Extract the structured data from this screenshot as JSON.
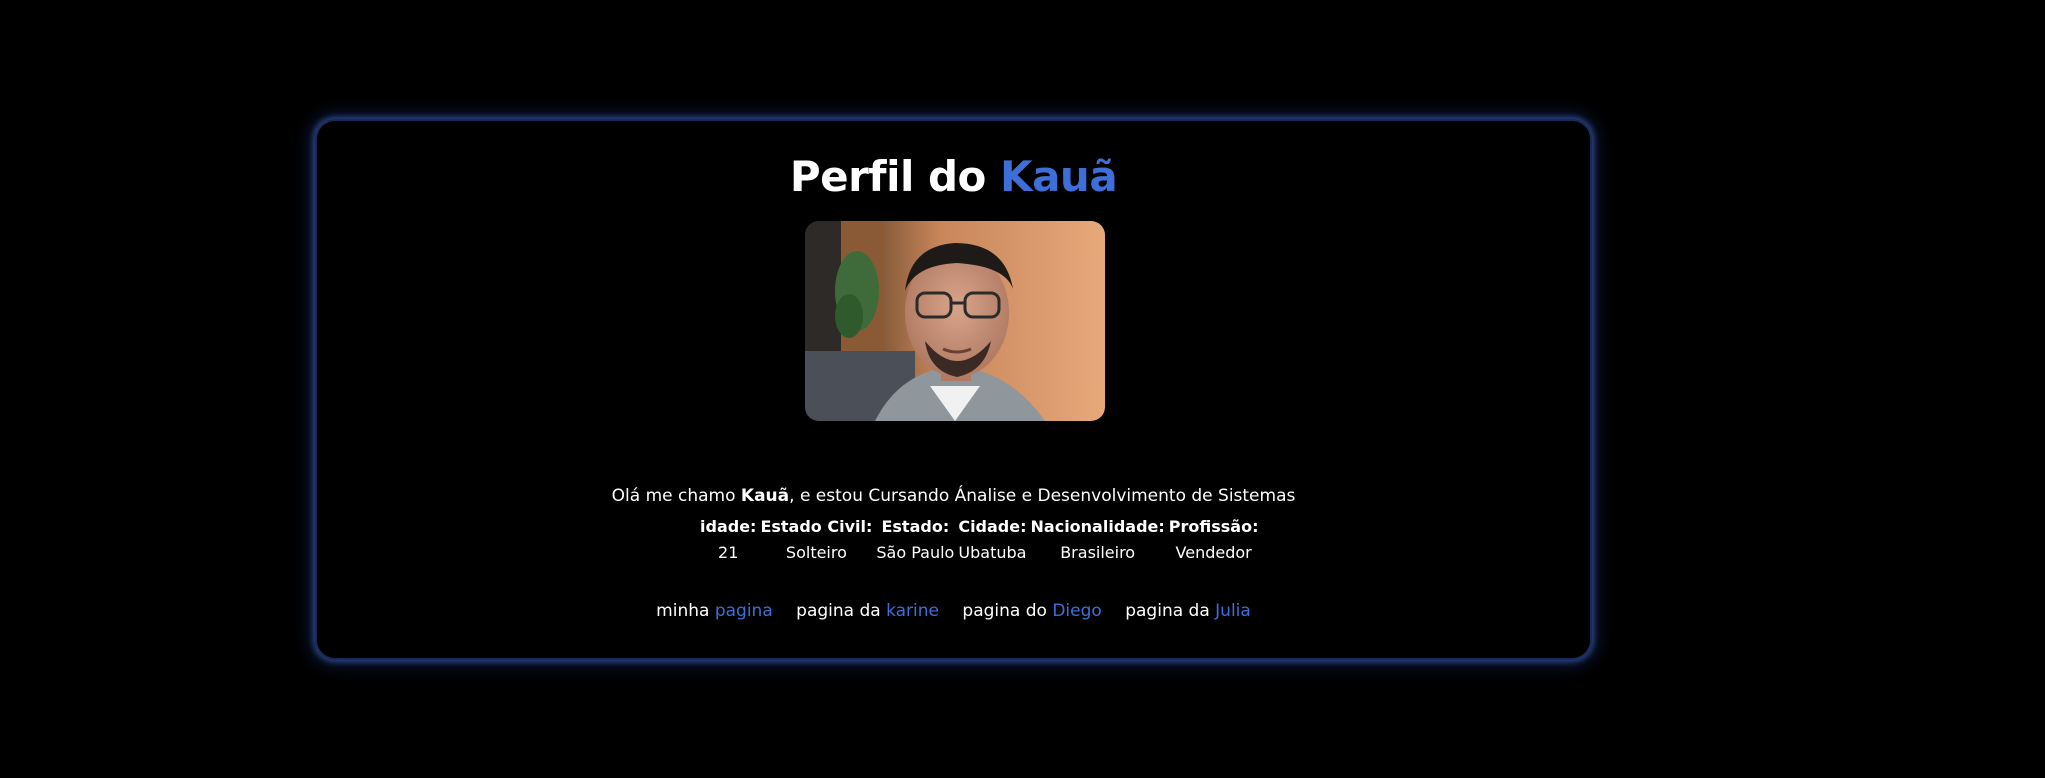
{
  "title": {
    "prefix": "Perfil do",
    "name": "Kauã"
  },
  "photo": {
    "icon": "profile-photo"
  },
  "intro": {
    "before": "Olá me chamo ",
    "name": "Kauã",
    "after": ", e estou Cursando Ánalise e Desenvolvimento de Sistemas"
  },
  "info": {
    "headers": [
      "idade:",
      "Estado Civil:",
      "Estado:",
      "Cidade:",
      "Nacionalidade:",
      "Profissão:"
    ],
    "values": [
      "21",
      "Solteiro",
      "São Paulo",
      "Ubatuba",
      "Brasileiro",
      "Vendedor"
    ]
  },
  "links": [
    {
      "prefix": "minha",
      "link": "pagina"
    },
    {
      "prefix": "pagina da",
      "link": "karine"
    },
    {
      "prefix": "pagina do",
      "link": "Diego"
    },
    {
      "prefix": "pagina da",
      "link": "Julia"
    }
  ],
  "colors": {
    "background": "#000000",
    "accent": "#3e6fd8",
    "glow": "#4a6fd0"
  }
}
